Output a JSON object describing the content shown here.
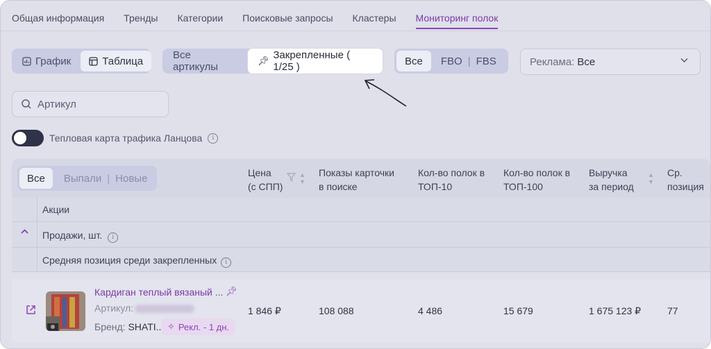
{
  "tabs": [
    "Общая информация",
    "Тренды",
    "Категории",
    "Поисковые запросы",
    "Кластеры",
    "Мониторинг полок"
  ],
  "view_toggle": {
    "chart_label": "График",
    "table_label": "Таблица"
  },
  "article_filter": {
    "all_label": "Все артикулы",
    "pinned_label": "Закрепленные ( 1/25 )"
  },
  "fulfillment": {
    "all": "Все",
    "fbo": "FBO",
    "sep": "|",
    "fbs": "FBS"
  },
  "ads_select": {
    "label": "Реклама:",
    "value": "Все"
  },
  "search": {
    "placeholder": "Артикул"
  },
  "heatmap_toggle": {
    "label": "Тепловая карта трафика Ланцова"
  },
  "row_filter": {
    "all": "Все",
    "dropped": "Выпали",
    "sep": "|",
    "new": "Новые"
  },
  "columns": {
    "price": [
      "Цена",
      "(с СПП)"
    ],
    "impressions": [
      "Показы карточки",
      "в поиске"
    ],
    "top10": [
      "Кол-во полок в",
      "ТОП-10"
    ],
    "top100": [
      "Кол-во полок в",
      "ТОП-100"
    ],
    "revenue": [
      "Выручка",
      "за период"
    ],
    "avg_pos": [
      "Ср.",
      "позиция"
    ]
  },
  "groups": {
    "promos": "Акции",
    "sales": "Продажи, шт.",
    "avg_position": "Средняя позиция среди закрепленных"
  },
  "product": {
    "name": "Кардиган теплый вязаный ...",
    "article_label": "Артикул:",
    "brand_label": "Бренд:",
    "brand_value": "SHATI...",
    "ad_badge": "Рекл. - 1 дн.",
    "price": "1 846 ₽",
    "impressions": "108 088",
    "top10": "4 486",
    "top100": "15 679",
    "revenue": "1 675 123 ₽",
    "avg_pos": "77"
  }
}
